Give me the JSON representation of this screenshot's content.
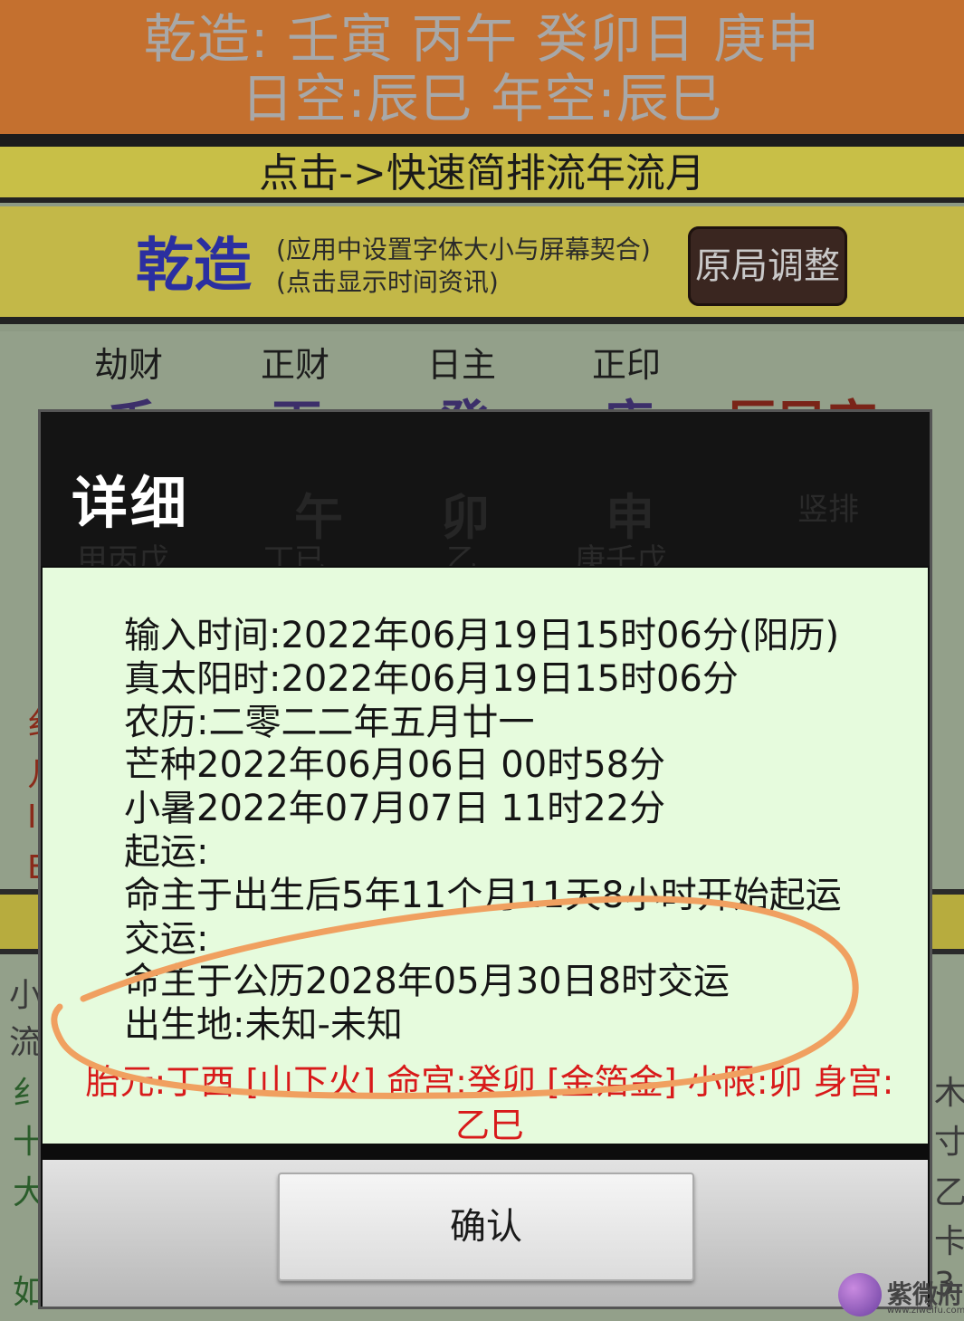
{
  "header": {
    "line1": "乾造: 壬寅 丙午 癸卯日 庚申",
    "line2": "日空:辰巳 年空:辰巳"
  },
  "quick_link": "点击->快速简排流年流月",
  "info_bar": {
    "gender_label": "乾造",
    "hint1": "(应用中设置字体大小与屏幕契合)",
    "hint2": "(点击显示时间资讯)",
    "adjust_button": "原局调整"
  },
  "chart": {
    "shishen": [
      "劫财",
      "正财",
      "日主",
      "正印"
    ],
    "tiangan": [
      "壬",
      "丙",
      "癸",
      "庚"
    ],
    "dizhi": [
      "午",
      "卯",
      "申"
    ],
    "kongwang": "辰巳空",
    "vertical_label": "竖排",
    "canggan": [
      "甲丙戊",
      "丁已",
      "乙",
      "庚壬戊"
    ],
    "left_partial": [
      "纟",
      "几",
      "I",
      "E",
      "小",
      "流",
      "纟",
      "十",
      "大",
      "如"
    ],
    "right_partial": [
      "木",
      "寸",
      "乙",
      "卡",
      "3"
    ]
  },
  "dialog": {
    "title": "详细",
    "lines": [
      "输入时间:2022年06月19日15时06分(阳历)",
      "真太阳时:2022年06月19日15时06分",
      "农历:二零二二年五月廿一",
      "芒种2022年06月06日 00时58分",
      "小暑2022年07月07日 11时22分",
      "起运:",
      "命主于出生后5年11个月11天8小时开始起运",
      "交运:",
      "命主于公历2028年05月30日8时交运",
      "出生地:未知-未知"
    ],
    "red_line1": "胎元:丁酉 [山下火] 命宫:癸卯 [金箔金] 小限:卯   身宫:",
    "red_line2": "乙巳",
    "confirm_button": "确认"
  },
  "watermark": {
    "text": "紫微府",
    "sub": "www.ziweifu.com"
  },
  "colors": {
    "header_bg": "#c4702f",
    "quick_bg": "#c8bf47",
    "dialog_body_bg": "#e6fbdd",
    "red_text": "#d81a1a",
    "annotation": "#f0a060"
  }
}
